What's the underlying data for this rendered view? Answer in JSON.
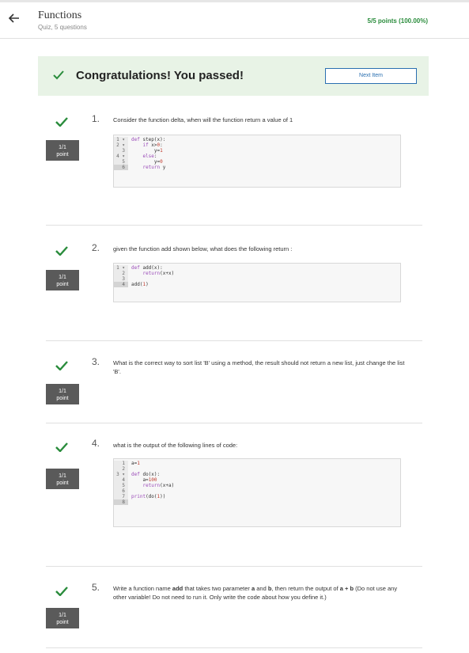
{
  "header": {
    "title": "Functions",
    "subtitle": "Quiz, 5 questions",
    "points": "5/5 points (100.00%)"
  },
  "banner": {
    "message": "Congratulations! You passed!",
    "next_button": "Next Item"
  },
  "colors": {
    "success_green": "#2a8c3c",
    "banner_bg": "#e8f3e6",
    "link_blue": "#2a6fb0",
    "score_box": "#5a5a5a"
  },
  "questions": [
    {
      "number": "1.",
      "score": "1/1",
      "score_unit": "point",
      "text": "Consider the function delta, when will the function return a value of 1",
      "code": [
        {
          "ln": "1 ▾",
          "src": "def step(x):"
        },
        {
          "ln": "2 ▾",
          "src": "    if x>0:"
        },
        {
          "ln": "3",
          "src": "        y=1"
        },
        {
          "ln": "4 ▾",
          "src": "    else:"
        },
        {
          "ln": "5",
          "src": "        y=0"
        },
        {
          "ln": "6",
          "src": "    return y"
        }
      ]
    },
    {
      "number": "2.",
      "score": "1/1",
      "score_unit": "point",
      "text": "given the function add shown below, what does the following return :",
      "code": [
        {
          "ln": "1 ▾",
          "src": "def add(x):"
        },
        {
          "ln": "2",
          "src": "    return(x+x)"
        },
        {
          "ln": "3",
          "src": ""
        },
        {
          "ln": "4",
          "src": "add(1)"
        }
      ]
    },
    {
      "number": "3.",
      "score": "1/1",
      "score_unit": "point",
      "text": "What is the correct way to sort list 'B' using a method, the result should not return a new list, just change the list 'B'."
    },
    {
      "number": "4.",
      "score": "1/1",
      "score_unit": "point",
      "text": "what is the output of the following lines of code:",
      "code": [
        {
          "ln": "1",
          "src": "a=1"
        },
        {
          "ln": "2",
          "src": ""
        },
        {
          "ln": "3 ▾",
          "src": "def do(x):"
        },
        {
          "ln": "4",
          "src": "    a=100"
        },
        {
          "ln": "5",
          "src": "    return(x+a)"
        },
        {
          "ln": "6",
          "src": ""
        },
        {
          "ln": "7",
          "src": "print(do(1))"
        },
        {
          "ln": "8",
          "src": ""
        }
      ]
    },
    {
      "number": "5.",
      "score": "1/1",
      "score_unit": "point",
      "text_parts": {
        "p1": "Write a function name ",
        "b1": "add",
        "p2": " that takes two parameter ",
        "b2": "a",
        "p3": " and ",
        "b3": "b",
        "p4": ", then return the output of ",
        "b4": "a + b",
        "p5": " (Do not use any other variable! Do not need to run it. Only write the code about how you define it.)"
      }
    }
  ]
}
